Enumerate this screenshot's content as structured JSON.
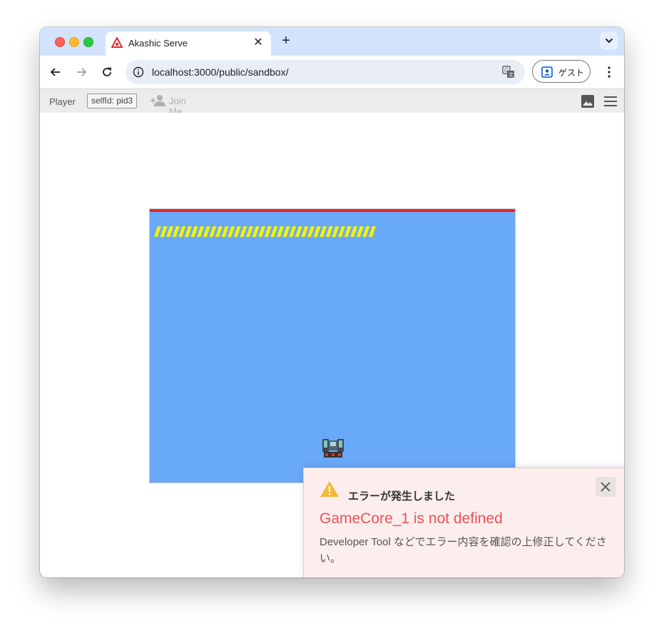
{
  "browser": {
    "tab_title": "Akashic Serve",
    "url": "localhost:3000/public/sandbox/",
    "profile_label": "ゲスト"
  },
  "devbar": {
    "player_label": "Player",
    "self_id": "selfId: pid3",
    "join_me": "Join Me"
  },
  "game": {
    "background_color": "#69a9f9",
    "top_bar_color": "#e8232d",
    "stripe_color": "#f2f20c"
  },
  "error_toast": {
    "heading": "エラーが発生しました",
    "error_message": "GameCore_1 is not defined",
    "description": "Developer Tool などでエラー内容を確認の上修正してください。"
  },
  "icons": {
    "favicon": "akashic-logo-icon",
    "back": "arrow-back-icon",
    "forward": "arrow-forward-icon",
    "reload": "reload-icon",
    "site_info": "info-icon",
    "translate": "translate-icon",
    "profile": "person-icon",
    "browser_menu": "kebab-menu-icon",
    "join_me": "person-add-icon",
    "image": "image-icon",
    "devtools_menu": "hamburger-menu-icon",
    "warning": "warning-icon",
    "close": "close-icon"
  }
}
